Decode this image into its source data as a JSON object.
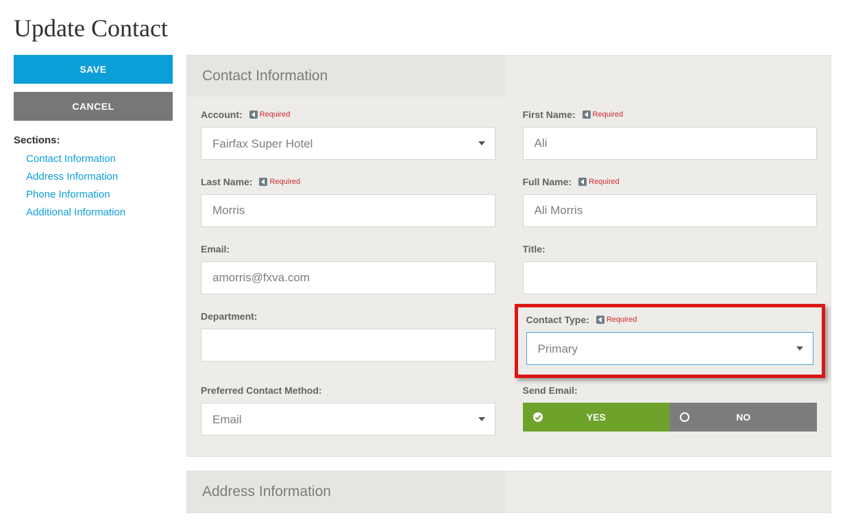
{
  "page_title": "Update Contact",
  "sidebar": {
    "save_label": "SAVE",
    "cancel_label": "CANCEL",
    "sections_heading": "Sections:",
    "links": [
      "Contact Information",
      "Address Information",
      "Phone Information",
      "Additional Information"
    ]
  },
  "panels": {
    "contact_info_title": "Contact Information",
    "address_info_title": "Address Information"
  },
  "labels": {
    "account": "Account:",
    "first_name": "First Name:",
    "last_name": "Last Name:",
    "full_name": "Full Name:",
    "email": "Email:",
    "title": "Title:",
    "department": "Department:",
    "contact_type": "Contact Type:",
    "preferred_contact_method": "Preferred Contact Method:",
    "send_email": "Send Email:",
    "required": "Required"
  },
  "values": {
    "account": "Fairfax Super Hotel",
    "first_name": "Ali",
    "last_name": "Morris",
    "full_name": "Ali Morris",
    "email": "amorris@fxva.com",
    "title": "",
    "department": "",
    "contact_type": "Primary",
    "preferred_contact_method": "Email",
    "send_email_yes": "YES",
    "send_email_no": "NO"
  }
}
